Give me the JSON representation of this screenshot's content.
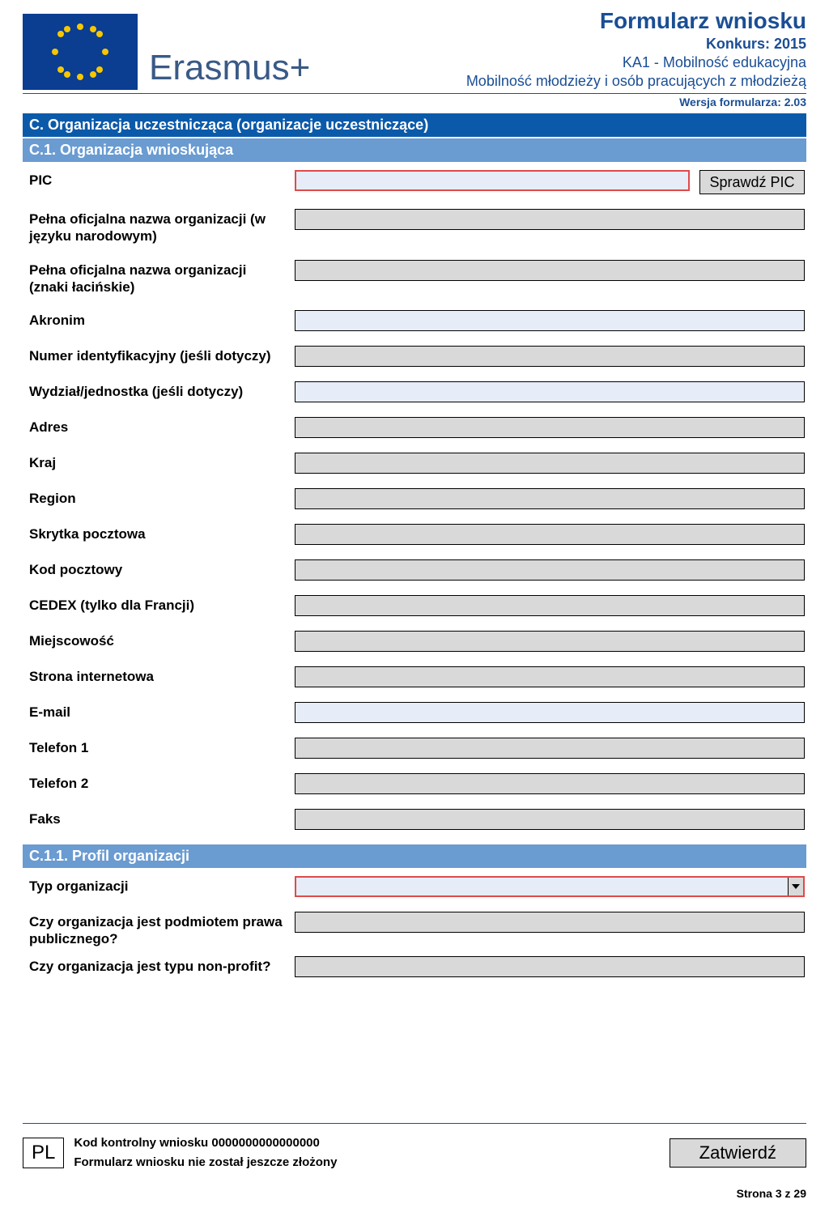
{
  "header": {
    "program": "Erasmus+",
    "title": "Formularz wniosku",
    "call": "Konkurs: 2015",
    "action": "KA1 - Mobilność edukacyjna",
    "subaction": "Mobilność młodzieży i osób pracujących z młodzieżą",
    "version": "Wersja formularza: 2.03"
  },
  "sections": {
    "c_title": "C. Organizacja uczestnicząca (organizacje uczestniczące)",
    "c1_title": "C.1. Organizacja wnioskująca",
    "c11_title": "C.1.1. Profil organizacji"
  },
  "fields": {
    "pic_label": "PIC",
    "pic_button": "Sprawdź PIC",
    "legal_name_national": "Pełna oficjalna nazwa organizacji (w języku narodowym)",
    "legal_name_latin": "Pełna oficjalna nazwa organizacji (znaki łacińskie)",
    "acronym": "Akronim",
    "national_id": "Numer identyfikacyjny (jeśli dotyczy)",
    "department": "Wydział/jednostka (jeśli dotyczy)",
    "address": "Adres",
    "country": "Kraj",
    "region": "Region",
    "po_box": "Skrytka pocztowa",
    "postal_code": "Kod pocztowy",
    "cedex": "CEDEX (tylko dla Francji)",
    "city": "Miejscowość",
    "website": "Strona internetowa",
    "email": "E-mail",
    "phone1": "Telefon 1",
    "phone2": "Telefon 2",
    "fax": "Faks",
    "org_type": "Typ organizacji",
    "public_body": "Czy organizacja jest podmiotem prawa publicznego?",
    "non_profit": "Czy organizacja jest typu non-profit?"
  },
  "footer": {
    "lang": "PL",
    "hash_label": "Kod kontrolny wniosku",
    "hash_value": "0000000000000000",
    "status": "Formularz wniosku nie został jeszcze złożony",
    "validate": "Zatwierdź",
    "page": "Strona 3 z 29"
  }
}
